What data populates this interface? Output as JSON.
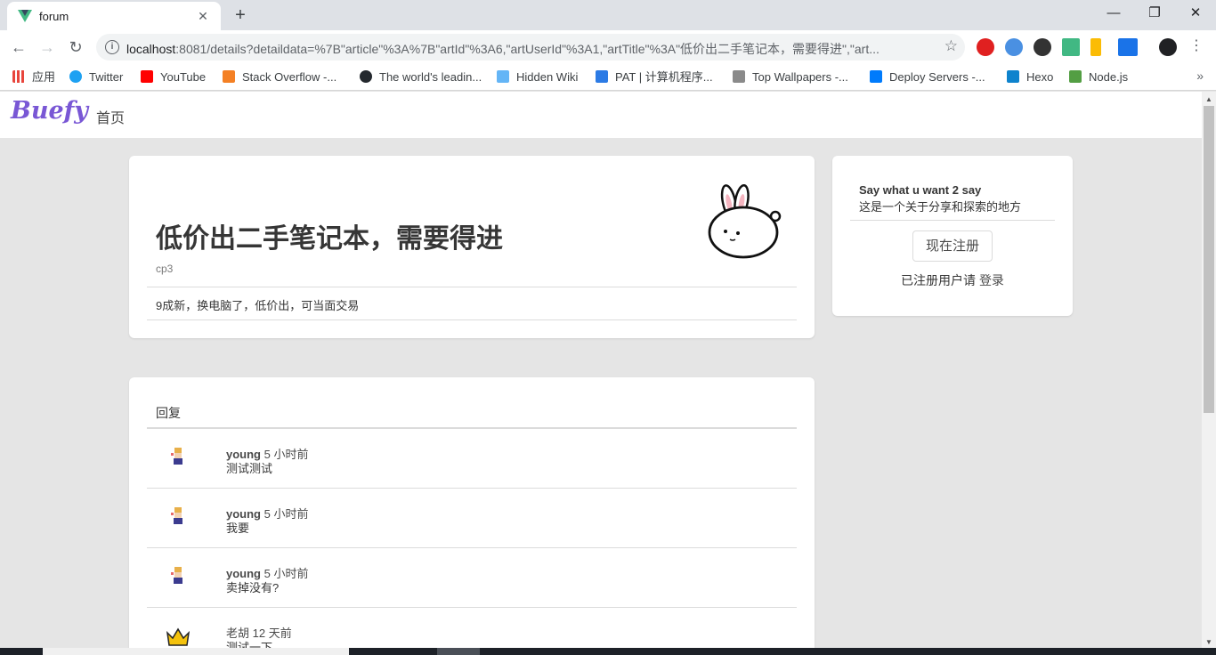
{
  "browser": {
    "tab_title": "forum",
    "url_host": "localhost",
    "url_path": ":8081/details?detaildata=%7B\"article\"%3A%7B\"artId\"%3A6,\"artUserId\"%3A1,\"artTitle\"%3A\"低价出二手笔记本，需要得进\",\"art...",
    "bookmarks": [
      {
        "label": "应用",
        "color": "#e8453c"
      },
      {
        "label": "Twitter",
        "color": "#1da1f2"
      },
      {
        "label": "YouTube",
        "color": "#ff0000"
      },
      {
        "label": "Stack Overflow -...",
        "color": "#f48024"
      },
      {
        "label": "The world's leadin...",
        "color": "#24292e"
      },
      {
        "label": "Hidden Wiki",
        "color": "#64b5f6"
      },
      {
        "label": "PAT | 计算机程序...",
        "color": "#2c7be5"
      },
      {
        "label": "Top Wallpapers -...",
        "color": "#8a8a8a"
      },
      {
        "label": "Deploy Servers -...",
        "color": "#007bfc"
      },
      {
        "label": "Hexo",
        "color": "#0e83cd"
      },
      {
        "label": "Node.js",
        "color": "#539e43"
      }
    ]
  },
  "nav": {
    "brand": "Buefy",
    "home": "首页"
  },
  "article": {
    "title": "低价出二手笔记本，需要得进",
    "author": "cp3",
    "content": "9成新，换电脑了，低价出，可当面交易"
  },
  "sidebar": {
    "heading": "Say what u want 2 say",
    "subtitle": "这是一个关于分享和探索的地方",
    "register": "现在注册",
    "login_prefix": "已注册用户请",
    "login_link": "登录"
  },
  "replies": {
    "heading": "回复",
    "items": [
      {
        "user": "young",
        "time": "5 小时前",
        "text": "测试测试",
        "avatar": "pixel-character"
      },
      {
        "user": "young",
        "time": "5 小时前",
        "text": "我要",
        "avatar": "pixel-character"
      },
      {
        "user": "young",
        "time": "5 小时前",
        "text": "卖掉没有?",
        "avatar": "pixel-character"
      },
      {
        "user": "老胡",
        "time": "12 天前",
        "text": "测试一下",
        "avatar": "crown"
      }
    ]
  },
  "colors": {
    "brand": "#7957d5",
    "background": "#e5e5e5"
  }
}
